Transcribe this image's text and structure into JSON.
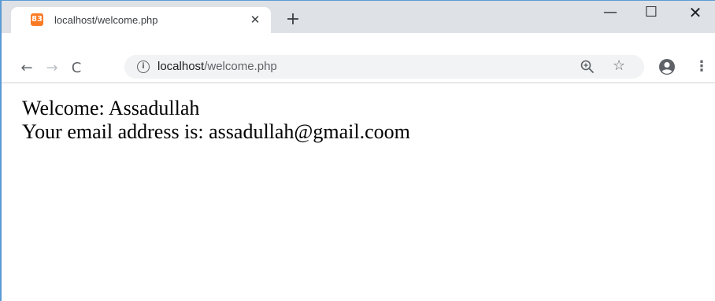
{
  "tab": {
    "title": "localhost/welcome.php",
    "favicon_glyph": "83",
    "favicon_color": "#fb7a24"
  },
  "toolbar": {
    "url_host": "localhost",
    "url_path": "/welcome.php"
  },
  "icons": {
    "back": "←",
    "forward": "→",
    "reload": "C",
    "info": "i",
    "star": "☆",
    "menu": "⋮",
    "close_tab": "✕",
    "new_tab": "+",
    "minimize": "—",
    "maximize": "☐",
    "close_window": "✕"
  },
  "page": {
    "welcome_line": "Welcome: Assadullah",
    "email_line": "Your email address is: assadullah@gmail.coom"
  },
  "colors": {
    "tabstrip": "#dee1e6",
    "omnibox": "#f1f3f4",
    "window_border": "#5b9bd5"
  }
}
